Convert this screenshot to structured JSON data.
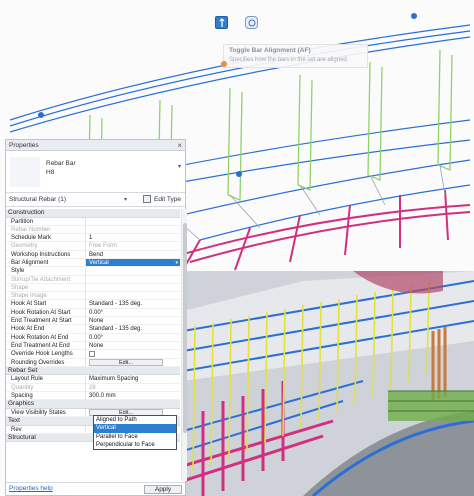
{
  "toolbar": {
    "align_icon": "rebar-alignment-icon",
    "path_icon": "path-rotate-icon"
  },
  "tooltip": {
    "title": "Toggle Bar Alignment (AF)",
    "description": "Specifies how the bars in the set are aligned."
  },
  "properties": {
    "title": "Properties",
    "type_name_line1": "Rebar Bar",
    "type_name_line2": "H8",
    "instance_filter": "Structural Rebar (1)",
    "edit_type_label": "Edit Type",
    "groups": [
      {
        "name": "Construction",
        "rows": [
          {
            "label": "Partition",
            "value": "",
            "disabled": false,
            "kind": "text"
          },
          {
            "label": "Rebar Number",
            "value": "",
            "disabled": true,
            "kind": "text"
          },
          {
            "label": "Schedule Mark",
            "value": "1",
            "disabled": false,
            "kind": "text"
          },
          {
            "label": "Geometry",
            "value": "Free Form",
            "disabled": true,
            "kind": "text"
          },
          {
            "label": "Workshop Instructions",
            "value": "Bend",
            "disabled": false,
            "kind": "text"
          },
          {
            "label": "Bar Alignment",
            "value": "Vertical",
            "disabled": false,
            "kind": "select"
          },
          {
            "label": "Style",
            "value": "",
            "disabled": false,
            "kind": "text"
          },
          {
            "label": "Stirrup/Tie Attachment",
            "value": "",
            "disabled": true,
            "kind": "text"
          },
          {
            "label": "Shape",
            "value": "",
            "disabled": true,
            "kind": "text"
          },
          {
            "label": "Shape Image",
            "value": "",
            "disabled": true,
            "kind": "text"
          },
          {
            "label": "Hook At Start",
            "value": "Standard - 135 deg.",
            "disabled": false,
            "kind": "text"
          },
          {
            "label": "Hook Rotation At Start",
            "value": "0.00°",
            "disabled": false,
            "kind": "text"
          },
          {
            "label": "End Treatment At Start",
            "value": "None",
            "disabled": false,
            "kind": "text"
          },
          {
            "label": "Hook At End",
            "value": "Standard - 135 deg.",
            "disabled": false,
            "kind": "text"
          },
          {
            "label": "Hook Rotation At End",
            "value": "0.00°",
            "disabled": false,
            "kind": "text"
          },
          {
            "label": "End Treatment At End",
            "value": "None",
            "disabled": false,
            "kind": "text"
          },
          {
            "label": "Override Hook Lengths",
            "value": "",
            "disabled": false,
            "kind": "checkbox"
          },
          {
            "label": "Rounding Overrides",
            "value": "Edit...",
            "disabled": false,
            "kind": "button"
          }
        ]
      },
      {
        "name": "Rebar Set",
        "rows": [
          {
            "label": "Layout Rule",
            "value": "Maximum Spacing",
            "disabled": false,
            "kind": "text"
          },
          {
            "label": "Quantity",
            "value": "28",
            "disabled": true,
            "kind": "text"
          },
          {
            "label": "Spacing",
            "value": "300.0 mm",
            "disabled": false,
            "kind": "text"
          }
        ]
      },
      {
        "name": "Graphics",
        "rows": [
          {
            "label": "View Visibility States",
            "value": "Edit...",
            "disabled": false,
            "kind": "button"
          }
        ]
      },
      {
        "name": "Text",
        "rows": [
          {
            "label": "Rev",
            "value": "",
            "disabled": false,
            "kind": "text"
          }
        ]
      },
      {
        "name": "Structural",
        "rows": []
      }
    ],
    "alignment_options": [
      "Aligned to Path",
      "Vertical",
      "Parallel to Face",
      "Perpendicular to Face"
    ],
    "alignment_selected": "Vertical",
    "help_link": "Properties help",
    "apply_label": "Apply"
  },
  "colors": {
    "selection_blue": "#2f7fd1",
    "rebar_blue": "#2a6fd6",
    "rebar_green": "#8fd36a",
    "rebar_magenta": "#d0307e",
    "rebar_yellow": "#e2e23a"
  }
}
